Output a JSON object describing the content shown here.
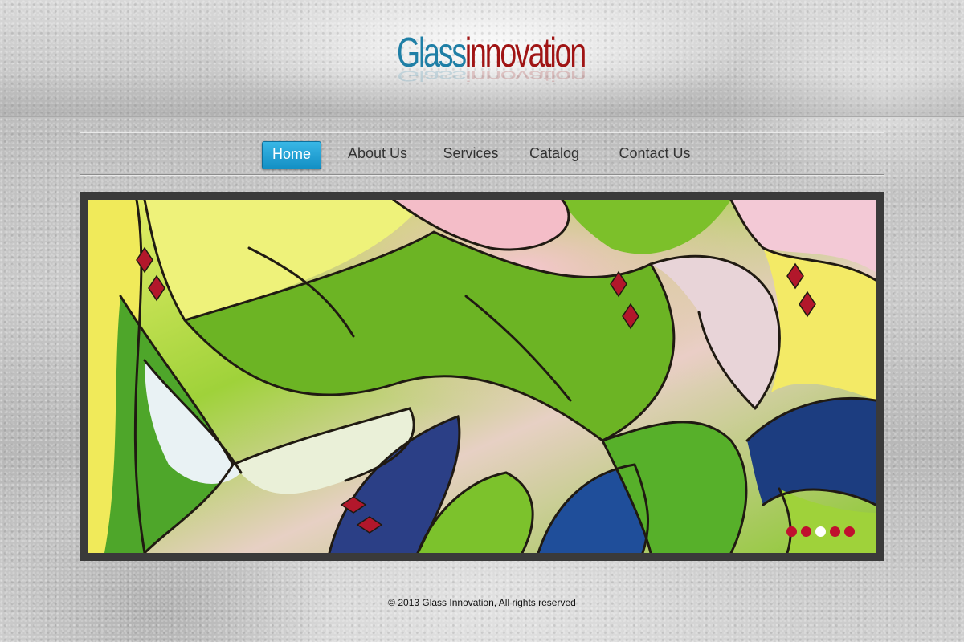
{
  "logo": {
    "part1": "Glass",
    "part2": "innovation",
    "colors": {
      "part1": "#1f7fa6",
      "part2": "#a01414"
    }
  },
  "nav": {
    "items": [
      {
        "label": "Home",
        "active": true
      },
      {
        "label": "About Us",
        "active": false
      },
      {
        "label": "Services",
        "active": false
      },
      {
        "label": "Catalog",
        "active": false
      },
      {
        "label": "Contact Us",
        "active": false
      }
    ],
    "active_color": "#1e9dd2"
  },
  "slider": {
    "image": "stained-glass-abstract",
    "slide_count": 5,
    "active_slide": 3,
    "dot_color": "#c0102e",
    "dot_active_color": "#ffffff"
  },
  "footer": {
    "text": "© 2013 Glass Innovation, All rights reserved"
  }
}
